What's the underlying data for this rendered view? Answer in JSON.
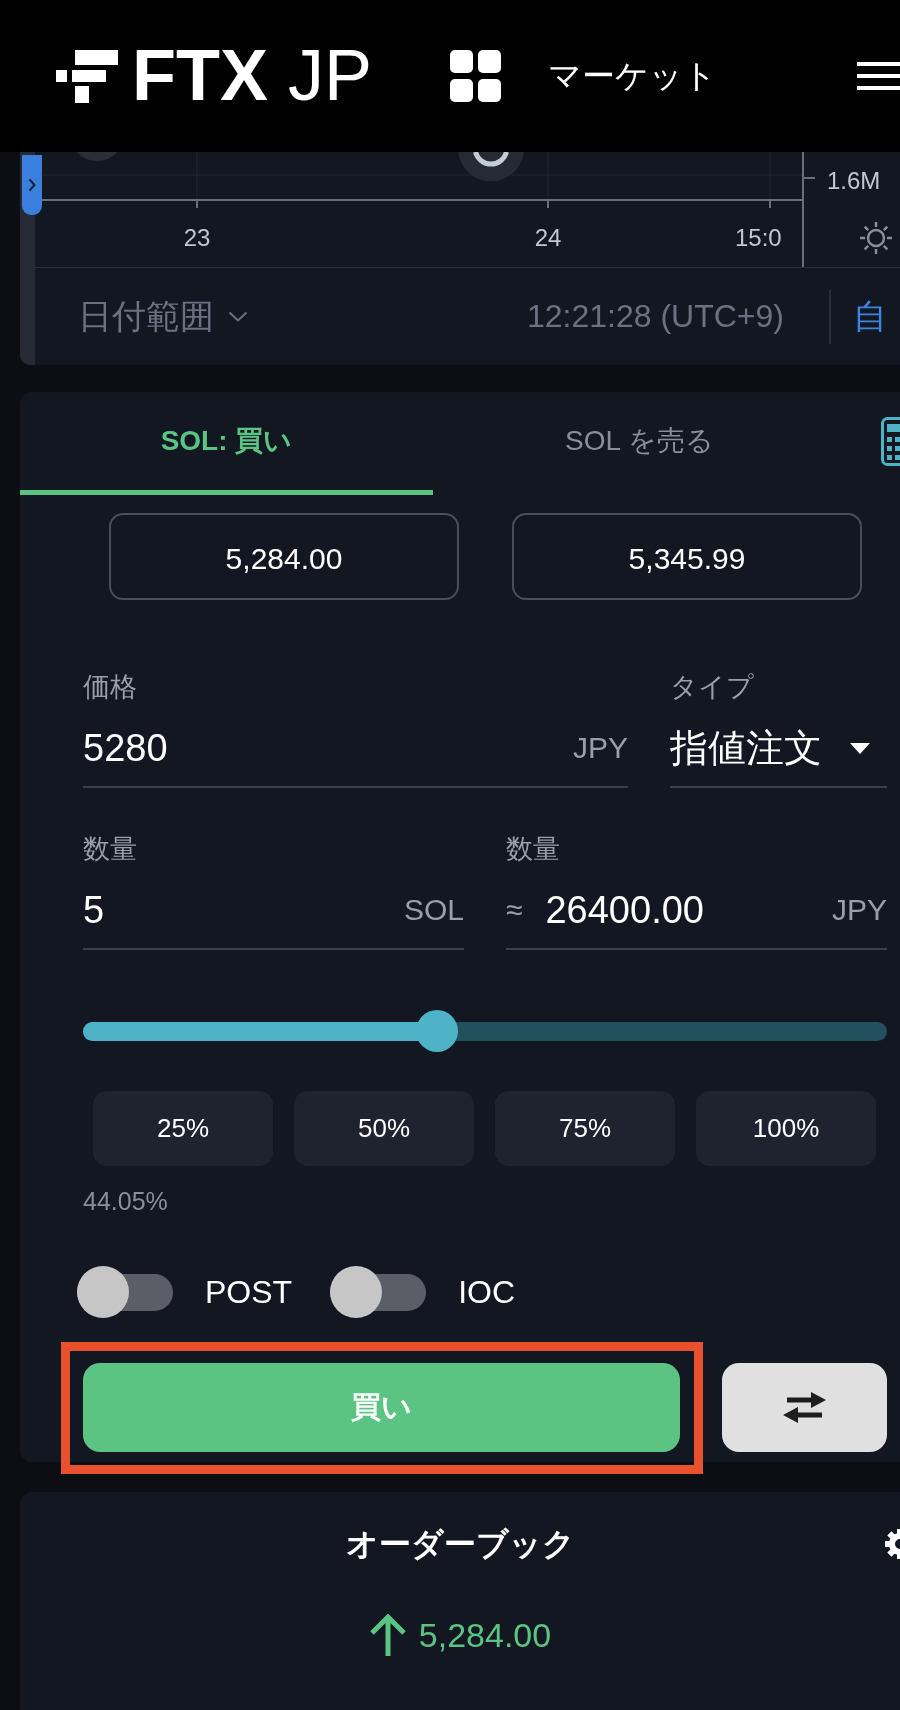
{
  "header": {
    "logo": "**FTX** JP",
    "nav_label": "マーケット"
  },
  "chart": {
    "y_axis_label": "1.6M",
    "x_axis_labels": [
      "23",
      "24",
      "15:0"
    ],
    "date_range": "日付範囲",
    "time": "12:21:28 (UTC+9)",
    "auto_label": "自"
  },
  "order_form": {
    "tabs": [
      {
        "label": "SOL: 買い",
        "selected": true
      },
      {
        "label": "SOL を売る",
        "selected": false
      }
    ],
    "quote_buttons": [
      "5,284.00",
      "5,345.99"
    ],
    "price": {
      "label": "価格",
      "value": "5280",
      "unit": "JPY"
    },
    "type": {
      "label": "タイプ",
      "value": "指値注文"
    },
    "amount": {
      "label": "数量",
      "value": "5",
      "unit": "SOL"
    },
    "total": {
      "label": "数量",
      "prefix": "≈",
      "value": "26400.00",
      "unit": "JPY"
    },
    "slider": {
      "level": 0.4405
    },
    "percent_buttons": [
      "25%",
      "50%",
      "75%",
      "100%"
    ],
    "percent_reading": "44.05%",
    "toggles": [
      {
        "label": "POST",
        "on": false
      },
      {
        "label": "IOC",
        "on": false
      }
    ],
    "submit": {
      "label": "買い",
      "highlighted": true
    }
  },
  "order_book": {
    "title": "オーダーブック",
    "last_price": "5,284.00",
    "rising": true
  }
}
